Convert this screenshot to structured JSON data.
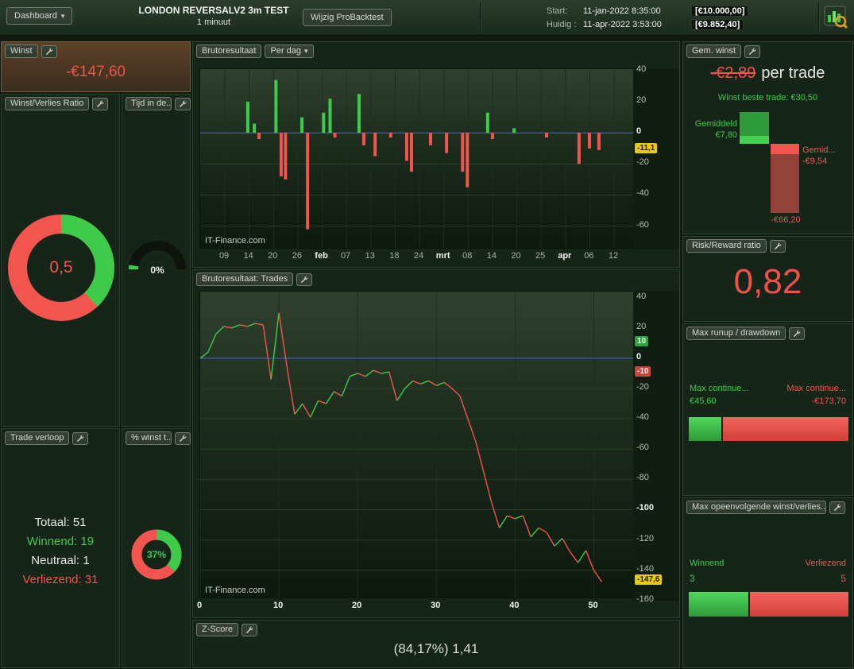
{
  "colors": {
    "green": "#3ecb4a",
    "red": "#f2544e",
    "zero_line_blue": "#4a63d8",
    "tag_yellow": "#eac813"
  },
  "header": {
    "dashboard_button": "Dashboard",
    "caret": "▾",
    "title": "LONDON REVERSALV2 3m TEST",
    "subtitle": "1 minuut",
    "edit_button": "Wijzig ProBacktest",
    "start_label": "Start:",
    "start_date": "11-jan-2022 8:35:00",
    "start_amount": "[€10.000,00]",
    "current_label": "Huidig :",
    "current_date": "11-apr-2022 3:53:00",
    "current_amount": "[€9.852,40]"
  },
  "panels": {
    "winst": {
      "title": "Winst",
      "value": "-€147,60"
    },
    "ratio": {
      "title": "Winst/Verlies Ratio",
      "value": "0,5"
    },
    "tijd": {
      "title": "Tijd in de...",
      "value": "0%"
    },
    "trade_verloop": {
      "title": "Trade verloop",
      "rows": [
        {
          "label": "Totaal:",
          "value": "51"
        },
        {
          "label": "Winnend:",
          "value": "19"
        },
        {
          "label": "Neutraal:",
          "value": "1"
        },
        {
          "label": "Verliezend:",
          "value": "31"
        }
      ]
    },
    "pct_winst": {
      "title": "% winst t...",
      "value": "37%"
    },
    "per_dag": {
      "title": "Brutoresultaat",
      "dropdown": "Per dag",
      "watermark": "IT-Finance.com"
    },
    "trades": {
      "title": "Brutoresultaat: Trades",
      "watermark": "IT-Finance.com"
    },
    "zscore": {
      "title": "Z-Score",
      "value": "(84,17%) 1,41"
    },
    "gem_winst": {
      "title": "Gem. winst",
      "value": "-€2,89",
      "suffix": "per trade",
      "best_line": "Winst beste trade: €30,50",
      "avg_win_label": "Gemiddeld",
      "avg_win": "€7,80",
      "avg_loss_label": "Gemid...",
      "avg_loss": "-€9,54",
      "worst": "-€66,20",
      "best_value": 30.5,
      "avg_win_value": 7.8,
      "avg_loss_value": 9.54,
      "worst_value": 66.2
    },
    "risk_reward": {
      "title": "Risk/Reward ratio",
      "value": "0,82"
    },
    "runup": {
      "title": "Max runup / drawdown",
      "up_label": "Max continue...",
      "up_value": "€45,60",
      "down_label": "Max continue...",
      "down_value": "-€173,70",
      "up": 45.6,
      "down": 173.7
    },
    "streak": {
      "title": "Max opeenvolgende winst/verlies...",
      "win_label": "Winnend",
      "win_value": "3",
      "loss_label": "Verliezend",
      "loss_value": "5",
      "win": 3,
      "loss": 5
    }
  },
  "chart_data": [
    {
      "type": "bar",
      "name": "brutoresultaat-per-dag",
      "title": "Brutoresultaat - Per dag",
      "ylim": [
        -74,
        41
      ],
      "y_ticks": [
        40,
        20,
        0,
        -20,
        -40,
        -60
      ],
      "x_tick_labels": [
        "09",
        "14",
        "20",
        "26",
        "feb",
        "07",
        "13",
        "18",
        "24",
        "mrt",
        "08",
        "14",
        "20",
        "25",
        "apr",
        "06",
        "12"
      ],
      "bold_ticks": [
        "feb",
        "mrt",
        "apr"
      ],
      "last_value": -11.1,
      "last_value_label": "-11,1",
      "bars": [
        {
          "x": 0.11,
          "v": 20
        },
        {
          "x": 0.125,
          "v": 6
        },
        {
          "x": 0.136,
          "v": -4
        },
        {
          "x": 0.175,
          "v": 34
        },
        {
          "x": 0.187,
          "v": -28
        },
        {
          "x": 0.197,
          "v": -30
        },
        {
          "x": 0.235,
          "v": 10
        },
        {
          "x": 0.248,
          "v": -62
        },
        {
          "x": 0.285,
          "v": 13
        },
        {
          "x": 0.3,
          "v": 22
        },
        {
          "x": 0.311,
          "v": -3
        },
        {
          "x": 0.367,
          "v": 25
        },
        {
          "x": 0.378,
          "v": -8
        },
        {
          "x": 0.404,
          "v": -15
        },
        {
          "x": 0.44,
          "v": -3
        },
        {
          "x": 0.477,
          "v": -18
        },
        {
          "x": 0.488,
          "v": -25
        },
        {
          "x": 0.532,
          "v": -8
        },
        {
          "x": 0.569,
          "v": -13
        },
        {
          "x": 0.606,
          "v": -25
        },
        {
          "x": 0.617,
          "v": -35
        },
        {
          "x": 0.664,
          "v": 13
        },
        {
          "x": 0.675,
          "v": -4
        },
        {
          "x": 0.725,
          "v": 3
        },
        {
          "x": 0.8,
          "v": -3
        },
        {
          "x": 0.875,
          "v": -20
        },
        {
          "x": 0.899,
          "v": -10
        },
        {
          "x": 0.921,
          "v": -11.1
        }
      ]
    },
    {
      "type": "line",
      "name": "brutoresultaat-trades",
      "title": "Brutoresultaat: Trades",
      "ylim": [
        -158,
        44
      ],
      "xlim": [
        0,
        55
      ],
      "y_ticks": [
        40,
        20,
        0,
        -20,
        -40,
        -60,
        -80,
        -100,
        -120,
        -140,
        -160
      ],
      "x_ticks": [
        0,
        10,
        20,
        30,
        40,
        50
      ],
      "values": [
        0,
        4,
        16,
        21,
        20,
        22,
        21,
        23,
        22,
        -14,
        30,
        -5,
        -37,
        -30,
        -39,
        -28,
        -30,
        -22,
        -25,
        -12,
        -10,
        -12,
        -8,
        -10,
        -9,
        -28,
        -20,
        -15,
        -17,
        -15,
        -18,
        -16,
        -20,
        -25,
        -40,
        -55,
        -75,
        -95,
        -112,
        -104,
        -106,
        -104,
        -118,
        -112,
        -115,
        -124,
        -119,
        -128,
        -135,
        -127,
        -140,
        -147.6
      ],
      "markers": {
        "up": 10,
        "up_label": "10",
        "down": -10,
        "down_label": "-10"
      },
      "last_value": -147.6,
      "last_value_label": "-147,6"
    },
    {
      "type": "pie",
      "name": "winst-verlies-ratio-donut",
      "green_pct": 38,
      "label": "0,5"
    },
    {
      "type": "pie",
      "name": "tijd-in-de-markt-gauge",
      "pct": 0,
      "label": "0%"
    },
    {
      "type": "pie",
      "name": "pct-winst-donut",
      "green_pct": 37,
      "label": "37%"
    }
  ]
}
